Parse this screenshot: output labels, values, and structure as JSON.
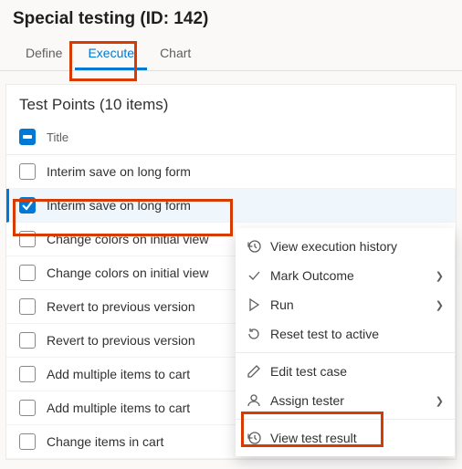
{
  "header": {
    "title": "Special testing (ID: 142)"
  },
  "tabs": {
    "items": [
      {
        "label": "Define"
      },
      {
        "label": "Execute"
      },
      {
        "label": "Chart"
      }
    ]
  },
  "panel": {
    "title": "Test Points (10 items)",
    "columnHeader": "Title",
    "rows": [
      {
        "title": "Interim save on long form",
        "checked": false
      },
      {
        "title": "Interim save on long form",
        "checked": true
      },
      {
        "title": "Change colors on initial view",
        "checked": false
      },
      {
        "title": "Change colors on initial view",
        "checked": false
      },
      {
        "title": "Revert to previous version",
        "checked": false
      },
      {
        "title": "Revert to previous version",
        "checked": false
      },
      {
        "title": "Add multiple items to cart",
        "checked": false
      },
      {
        "title": "Add multiple items to cart",
        "checked": false
      },
      {
        "title": "Change items in cart",
        "checked": false
      }
    ]
  },
  "contextMenu": {
    "items": [
      {
        "label": "View execution history",
        "icon": "history-icon",
        "submenu": false
      },
      {
        "label": "Mark Outcome",
        "icon": "check-icon",
        "submenu": true
      },
      {
        "label": "Run",
        "icon": "play-icon",
        "submenu": true
      },
      {
        "label": "Reset test to active",
        "icon": "reset-icon",
        "submenu": false
      },
      {
        "divider": true
      },
      {
        "label": "Edit test case",
        "icon": "edit-icon",
        "submenu": false
      },
      {
        "label": "Assign tester",
        "icon": "person-icon",
        "submenu": true
      },
      {
        "divider": true
      },
      {
        "label": "View test result",
        "icon": "history-icon",
        "submenu": false
      }
    ]
  }
}
